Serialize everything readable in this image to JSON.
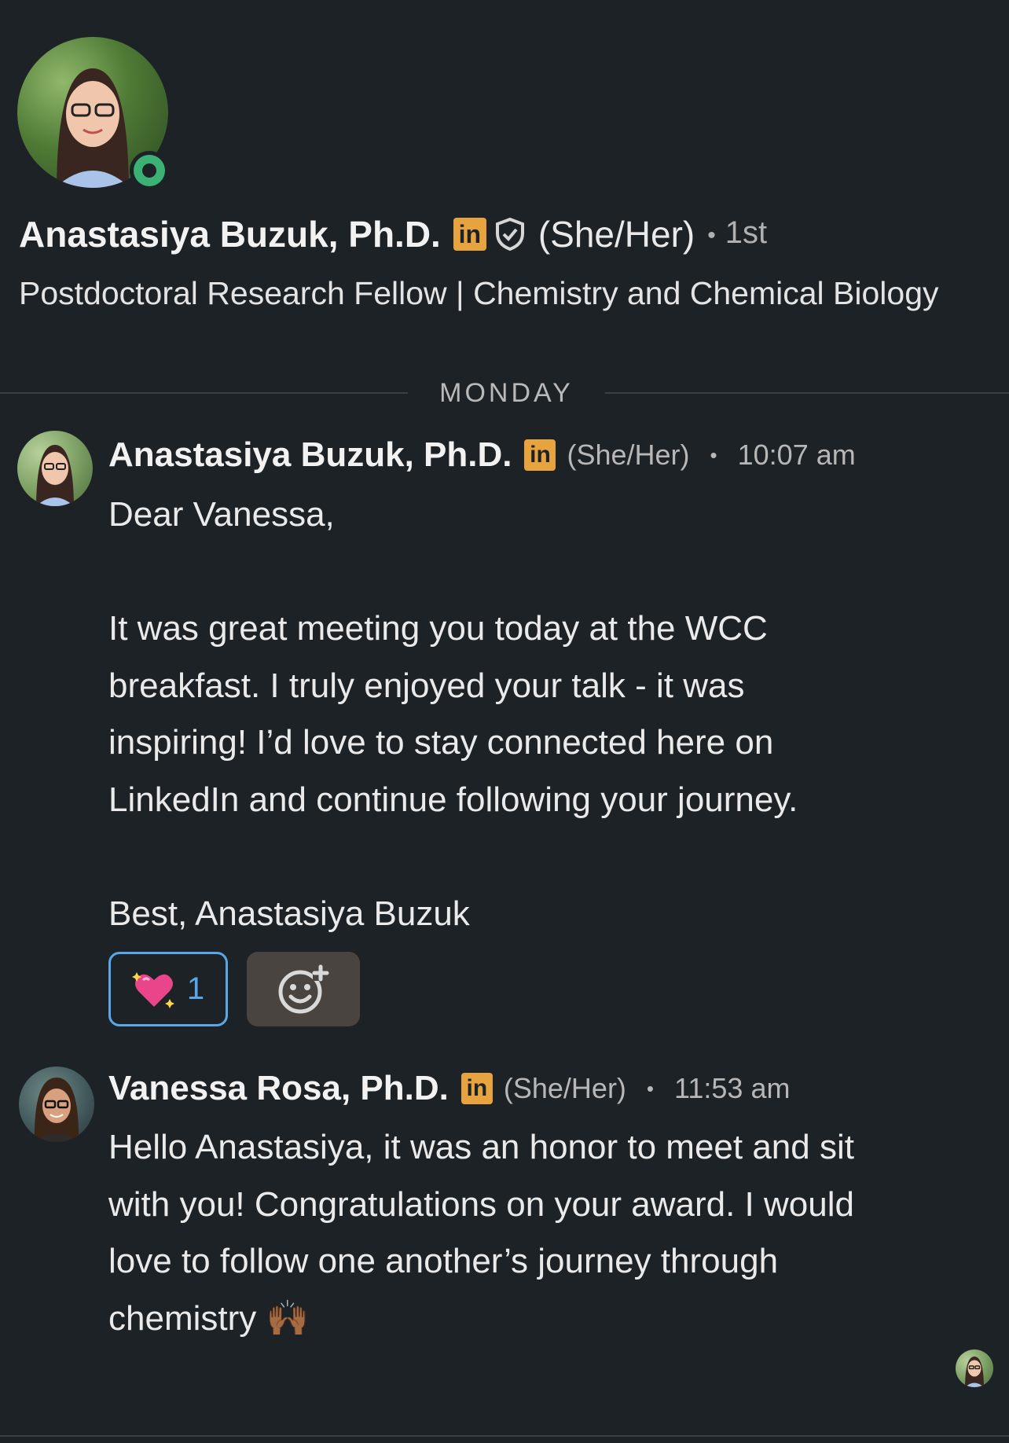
{
  "profile": {
    "name": "Anastasiya Buzuk, Ph.D.",
    "pronouns": "(She/Her)",
    "degree": "1st",
    "degree_dot": "•",
    "headline": "Postdoctoral Research Fellow | Chemistry and Chemical Biology",
    "online": true
  },
  "badges": {
    "linkedin": "in"
  },
  "divider": {
    "label": "MONDAY"
  },
  "messages": [
    {
      "sender": "Anastasiya Buzuk, Ph.D.",
      "pronouns": "(She/Her)",
      "separator": "•",
      "time": "10:07 am",
      "lines": [
        "Dear Vanessa,",
        "It was great meeting you today at the WCC",
        "breakfast. I truly enjoyed your talk - it was",
        "inspiring! I’d love to stay connected here on",
        "LinkedIn and continue following your journey.",
        "Best, Anastasiya Buzuk"
      ],
      "reaction": {
        "emoji": "💖",
        "count": "1"
      }
    },
    {
      "sender": "Vanessa Rosa, Ph.D.",
      "pronouns": "(She/Her)",
      "separator": "•",
      "time": "11:53 am",
      "lines": [
        "Hello Anastasiya, it was an honor to meet and sit",
        "with you! Congratulations on your award. I would",
        "love to follow one another’s journey through",
        "chemistry 🙌🏾"
      ]
    }
  ],
  "colors": {
    "background": "#1d2226",
    "linkedin_badge": "#e7a33e",
    "online": "#3bb273",
    "reaction_border": "#5aa7e8"
  }
}
